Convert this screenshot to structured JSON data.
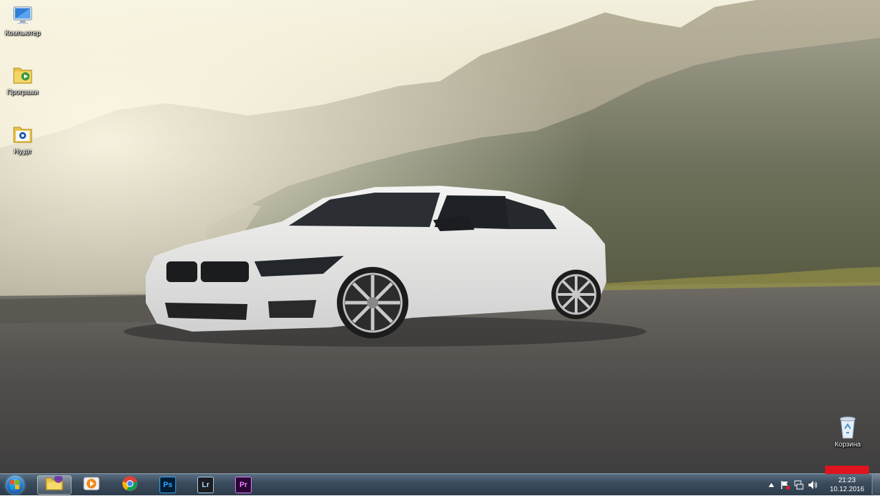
{
  "desktop": {
    "icons": [
      {
        "label": "Компьютер",
        "icon": "computer-icon"
      },
      {
        "label": "Програми",
        "icon": "programs-folder-icon"
      },
      {
        "label": "Ну,де",
        "icon": "shortcut-folder-icon"
      },
      {
        "label": "Корзина",
        "icon": "recycle-bin-icon"
      }
    ]
  },
  "taskbar": {
    "start": {
      "icon": "windows-start-icon"
    },
    "apps": [
      {
        "icon": "file-explorer-icon",
        "active": true
      },
      {
        "icon": "media-player-icon"
      },
      {
        "icon": "chrome-icon"
      },
      {
        "label": "Ps",
        "icon": "photoshop-icon",
        "bg": "#001d34",
        "fg": "#31a8ff"
      },
      {
        "label": "Lr",
        "icon": "lightroom-icon",
        "bg": "#1b1d22",
        "fg": "#add5ec"
      },
      {
        "label": "Pr",
        "icon": "premiere-icon",
        "bg": "#2a0634",
        "fg": "#e77cff"
      }
    ],
    "tray": {
      "icons": [
        "show-hidden-icons-arrow",
        "action-center-flag-icon",
        "network-icon",
        "volume-icon"
      ],
      "time": "21:23",
      "date": "10.12.2016"
    }
  }
}
